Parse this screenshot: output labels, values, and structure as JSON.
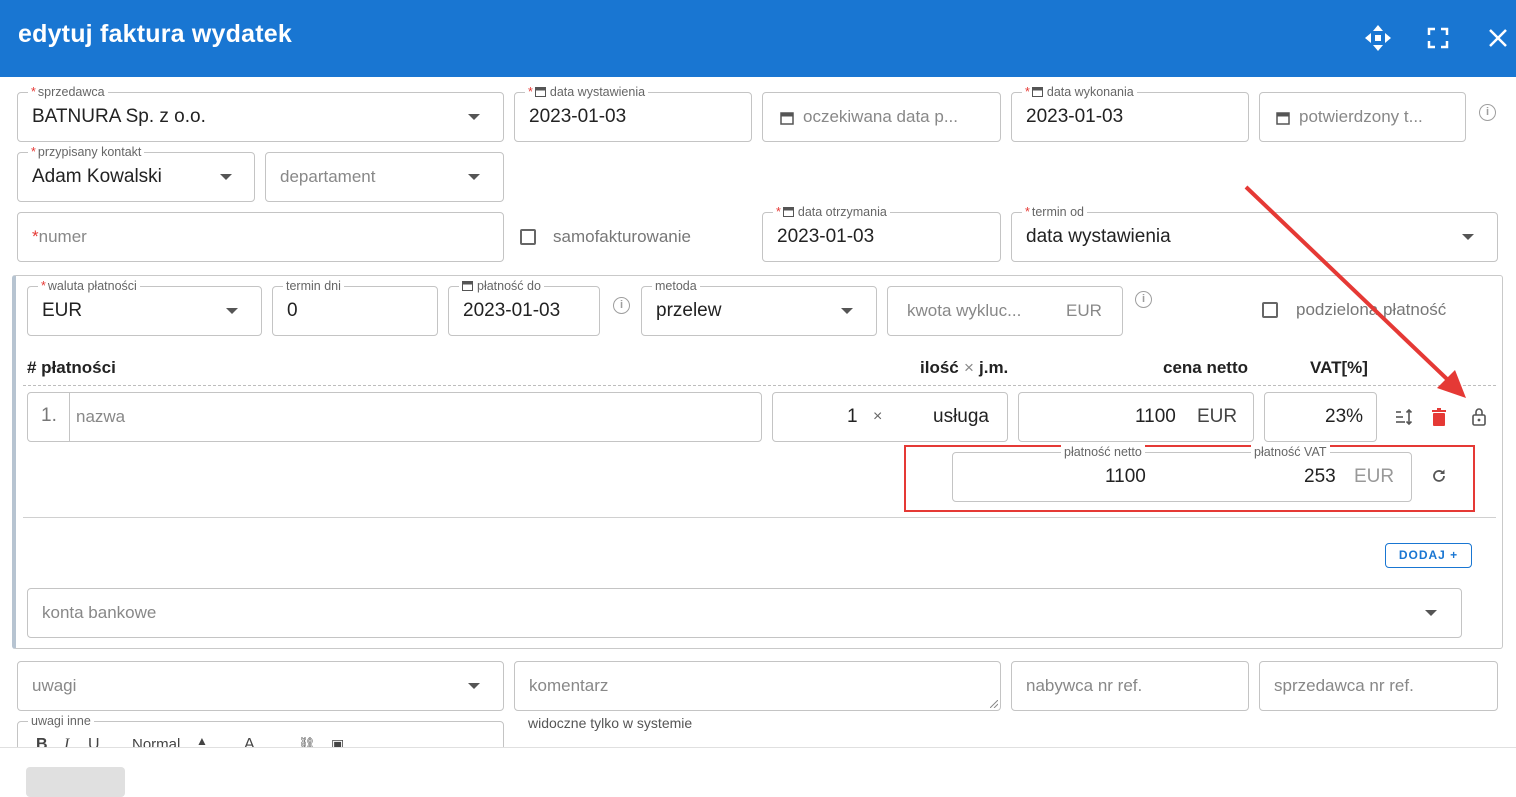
{
  "header": {
    "title": "edytuj  faktura wydatek"
  },
  "row1": {
    "seller": {
      "label": "sprzedawca",
      "value": "BATNURA Sp. z o.o."
    },
    "issue_date": {
      "label": "data wystawienia",
      "value": "2023-01-03"
    },
    "expected_date": {
      "placeholder": "oczekiwana data p..."
    },
    "exec_date": {
      "label": "data wykonania",
      "value": "2023-01-03"
    },
    "confirmed": {
      "placeholder": "potwierdzony t..."
    }
  },
  "row2": {
    "contact": {
      "label": "przypisany kontakt",
      "value": "Adam Kowalski"
    },
    "department": {
      "placeholder": "departament"
    }
  },
  "row3": {
    "number": {
      "placeholder": "numer"
    },
    "selfinvoice": {
      "label": "samofakturowanie"
    },
    "received_date": {
      "label": "data otrzymania",
      "value": "2023-01-03"
    },
    "term_from": {
      "label": "termin od",
      "value": "data wystawienia"
    }
  },
  "payment": {
    "currency": {
      "label": "waluta płatności",
      "value": "EUR"
    },
    "term_days": {
      "label": "termin dni",
      "value": "0"
    },
    "due_date": {
      "label": "płatność do",
      "value": "2023-01-03"
    },
    "method": {
      "label": "metoda",
      "value": "przelew"
    },
    "excluded": {
      "placeholder": "kwota wykluc...",
      "currency": "EUR"
    },
    "split": {
      "label": "podzielona płatność"
    }
  },
  "table": {
    "col_hash": "# płatności",
    "col_qty": "ilość",
    "col_x": "×",
    "col_unit": "j.m.",
    "col_price": "cena netto",
    "col_vat": "VAT[%]"
  },
  "item": {
    "index": "1.",
    "name_placeholder": "nazwa",
    "qty": "1",
    "times": "×",
    "unit": "usługa",
    "price": "1100",
    "price_currency": "EUR",
    "vat": "23%",
    "net_label": "płatność netto",
    "net_value": "1100",
    "vat_label": "płatność VAT",
    "vat_value": "253",
    "vat_currency": "EUR"
  },
  "add_button": "DODAJ +",
  "bank": {
    "placeholder": "konta bankowe"
  },
  "bottom": {
    "remarks": {
      "placeholder": "uwagi"
    },
    "comment": {
      "placeholder": "komentarz",
      "hint": "widoczne tylko w systemie"
    },
    "buyer_ref": {
      "placeholder": "nabywca nr ref."
    },
    "seller_ref": {
      "placeholder": "sprzedawca nr ref."
    },
    "other_remarks": {
      "label": "uwagi inne",
      "format_value": "Normal"
    }
  },
  "colors": {
    "header": "#1976d2",
    "required": "#e53935",
    "highlight": "#e53935",
    "delete": "#e53935"
  }
}
